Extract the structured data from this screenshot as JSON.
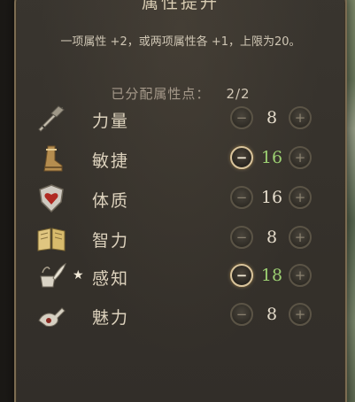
{
  "window": {
    "title": "属性提升",
    "subtitle": "一项属性 +2，或两项属性各 +1，上限为20。"
  },
  "points": {
    "label": "已分配属性点：",
    "value": "2/2"
  },
  "buttons": {
    "minus_symbol": "−",
    "plus_symbol": "+"
  },
  "colors": {
    "panel_bg": "#35312b",
    "panel_border": "#7c6c52",
    "text": "#ddd2bd",
    "boosted_value": "#9ccf72",
    "active_button_ring": "#d9c49c"
  },
  "attributes": [
    {
      "name": "力量",
      "value": "8",
      "icon": "sword-gauntlet-icon",
      "boosted": false,
      "starred": false
    },
    {
      "name": "敏捷",
      "value": "16",
      "icon": "boot-icon",
      "boosted": true,
      "starred": false
    },
    {
      "name": "体质",
      "value": "16",
      "icon": "shield-heart-icon",
      "boosted": false,
      "starred": false
    },
    {
      "name": "智力",
      "value": "8",
      "icon": "open-book-icon",
      "boosted": false,
      "starred": false
    },
    {
      "name": "感知",
      "value": "18",
      "icon": "herb-mortar-icon",
      "boosted": true,
      "starred": true,
      "star_symbol": "★"
    },
    {
      "name": "魅力",
      "value": "8",
      "icon": "lute-hand-icon",
      "boosted": false,
      "starred": false
    }
  ]
}
